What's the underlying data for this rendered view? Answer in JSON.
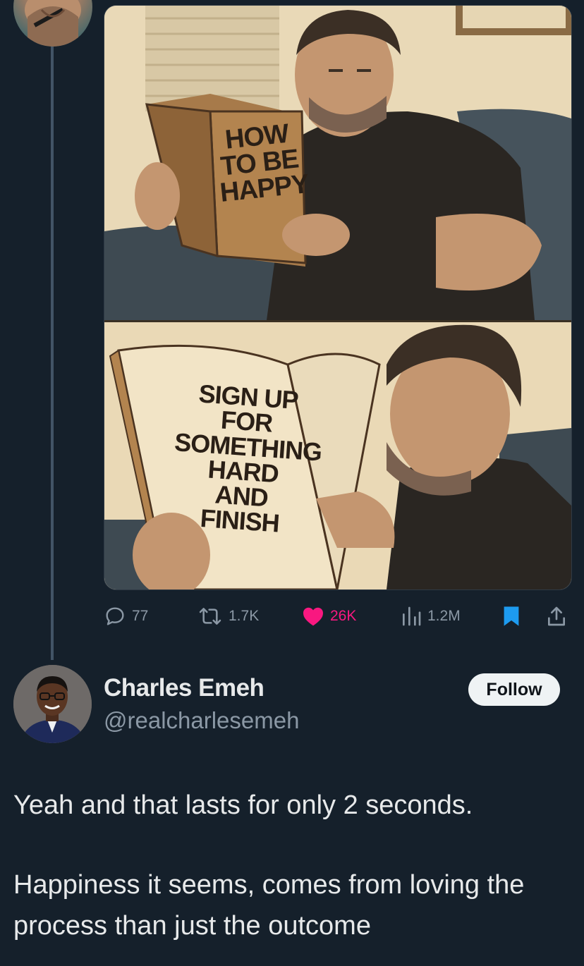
{
  "media": {
    "top_book_title": "HOW TO BE HAPPY",
    "top_book_lines": [
      "HOW",
      "TO BE",
      "HAPPY"
    ],
    "bottom_book_lines": [
      "SIGN UP",
      "FOR",
      "SOMETHING",
      "HARD",
      "AND",
      "FINISH"
    ]
  },
  "actions": {
    "replies": "77",
    "reposts": "1.7K",
    "likes": "26K",
    "views": "1.2M",
    "icons": [
      "reply-icon",
      "repost-icon",
      "heart-icon",
      "views-icon",
      "bookmark-icon",
      "share-icon"
    ]
  },
  "author": {
    "name": "Charles Emeh",
    "handle": "@realcharlesemeh",
    "follow_label": "Follow"
  },
  "tweet": {
    "line1": "Yeah and that lasts for only 2 seconds.",
    "line2": "Happiness it seems, comes from loving the process than just the outcome"
  },
  "colors": {
    "background": "#15202b",
    "like": "#f91880",
    "bookmark": "#1d9bf0",
    "muted": "#8b98a5"
  }
}
